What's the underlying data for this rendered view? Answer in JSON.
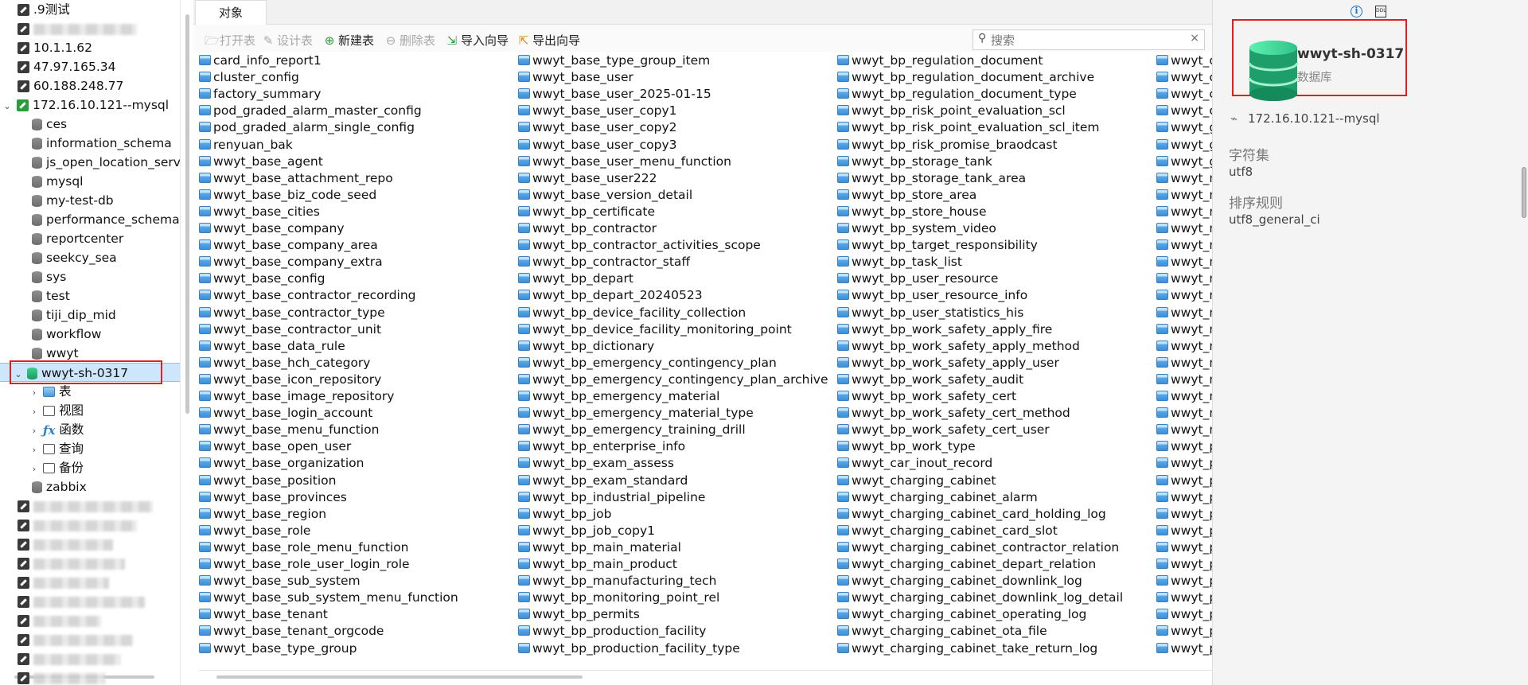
{
  "tree": {
    "connections_top": [
      {
        "label": ".9测试",
        "blurred": false
      },
      {
        "label": "",
        "blurred": true
      },
      {
        "label": "10.1.1.62",
        "blurred": false
      },
      {
        "label": "47.97.165.34",
        "blurred": false
      },
      {
        "label": "60.188.248.77",
        "blurred": false
      }
    ],
    "active_connection": "172.16.10.121--mysql",
    "databases": [
      "ces",
      "information_schema",
      "js_open_location_serve",
      "mysql",
      "my-test-db",
      "performance_schema",
      "reportcenter",
      "seekcy_sea",
      "sys",
      "test",
      "tiji_dip_mid",
      "workflow",
      "wwyt"
    ],
    "selected_database": "wwyt-sh-0317",
    "sub_nodes": [
      {
        "label": "表",
        "icon": "table-icon"
      },
      {
        "label": "视图",
        "icon": "view-icon"
      },
      {
        "label": "函数",
        "icon": "function-icon"
      },
      {
        "label": "查询",
        "icon": "query-icon"
      },
      {
        "label": "备份",
        "icon": "backup-icon"
      }
    ],
    "last_database": "zabbix"
  },
  "tabs": {
    "objects": "对象"
  },
  "toolbar": {
    "open_table": "打开表",
    "design_table": "设计表",
    "new_table": "新建表",
    "delete_table": "删除表",
    "import_wizard": "导入向导",
    "export_wizard": "导出向导"
  },
  "search": {
    "placeholder": "搜索",
    "value": ""
  },
  "tables": {
    "col1": [
      "card_info_report1",
      "cluster_config",
      "factory_summary",
      "pod_graded_alarm_master_config",
      "pod_graded_alarm_single_config",
      "renyuan_bak",
      "wwyt_base_agent",
      "wwyt_base_attachment_repo",
      "wwyt_base_biz_code_seed",
      "wwyt_base_cities",
      "wwyt_base_company",
      "wwyt_base_company_area",
      "wwyt_base_company_extra",
      "wwyt_base_config",
      "wwyt_base_contractor_recording",
      "wwyt_base_contractor_type",
      "wwyt_base_contractor_unit",
      "wwyt_base_data_rule",
      "wwyt_base_hch_category",
      "wwyt_base_icon_repository",
      "wwyt_base_image_repository",
      "wwyt_base_login_account",
      "wwyt_base_menu_function",
      "wwyt_base_open_user",
      "wwyt_base_organization",
      "wwyt_base_position",
      "wwyt_base_provinces",
      "wwyt_base_region",
      "wwyt_base_role",
      "wwyt_base_role_menu_function",
      "wwyt_base_role_user_login_role",
      "wwyt_base_sub_system",
      "wwyt_base_sub_system_menu_function",
      "wwyt_base_tenant",
      "wwyt_base_tenant_orgcode",
      "wwyt_base_type_group"
    ],
    "col2": [
      "wwyt_base_type_group_item",
      "wwyt_base_user",
      "wwyt_base_user_2025-01-15",
      "wwyt_base_user_copy1",
      "wwyt_base_user_copy2",
      "wwyt_base_user_copy3",
      "wwyt_base_user_menu_function",
      "wwyt_base_user222",
      "wwyt_base_version_detail",
      "wwyt_bp_certificate",
      "wwyt_bp_contractor",
      "wwyt_bp_contractor_activities_scope",
      "wwyt_bp_contractor_staff",
      "wwyt_bp_depart",
      "wwyt_bp_depart_20240523",
      "wwyt_bp_device_facility_collection",
      "wwyt_bp_device_facility_monitoring_point",
      "wwyt_bp_dictionary",
      "wwyt_bp_emergency_contingency_plan",
      "wwyt_bp_emergency_contingency_plan_archive",
      "wwyt_bp_emergency_material",
      "wwyt_bp_emergency_material_type",
      "wwyt_bp_emergency_training_drill",
      "wwyt_bp_enterprise_info",
      "wwyt_bp_exam_assess",
      "wwyt_bp_exam_standard",
      "wwyt_bp_industrial_pipeline",
      "wwyt_bp_job",
      "wwyt_bp_job_copy1",
      "wwyt_bp_main_material",
      "wwyt_bp_main_product",
      "wwyt_bp_manufacturing_tech",
      "wwyt_bp_monitoring_point_rel",
      "wwyt_bp_permits",
      "wwyt_bp_production_facility",
      "wwyt_bp_production_facility_type"
    ],
    "col3": [
      "wwyt_bp_regulation_document",
      "wwyt_bp_regulation_document_archive",
      "wwyt_bp_regulation_document_type",
      "wwyt_bp_risk_point_evaluation_scl",
      "wwyt_bp_risk_point_evaluation_scl_item",
      "wwyt_bp_risk_promise_braodcast",
      "wwyt_bp_storage_tank",
      "wwyt_bp_storage_tank_area",
      "wwyt_bp_store_area",
      "wwyt_bp_store_house",
      "wwyt_bp_system_video",
      "wwyt_bp_target_responsibility",
      "wwyt_bp_task_list",
      "wwyt_bp_user_resource",
      "wwyt_bp_user_resource_info",
      "wwyt_bp_user_statistics_his",
      "wwyt_bp_work_safety_apply_fire",
      "wwyt_bp_work_safety_apply_method",
      "wwyt_bp_work_safety_apply_user",
      "wwyt_bp_work_safety_audit",
      "wwyt_bp_work_safety_cert",
      "wwyt_bp_work_safety_cert_method",
      "wwyt_bp_work_safety_cert_user",
      "wwyt_bp_work_type",
      "wwyt_car_inout_record",
      "wwyt_charging_cabinet",
      "wwyt_charging_cabinet_alarm",
      "wwyt_charging_cabinet_card_holding_log",
      "wwyt_charging_cabinet_card_slot",
      "wwyt_charging_cabinet_contractor_relation",
      "wwyt_charging_cabinet_depart_relation",
      "wwyt_charging_cabinet_downlink_log",
      "wwyt_charging_cabinet_downlink_log_detail",
      "wwyt_charging_cabinet_operating_log",
      "wwyt_charging_cabinet_ota_file",
      "wwyt_charging_cabinet_take_return_log"
    ],
    "col4": [
      "wwyt_c",
      "wwyt_c",
      "wwyt_c",
      "wwyt_c",
      "wwyt_g",
      "wwyt_g",
      "wwyt_g",
      "wwyt_n",
      "wwyt_n",
      "wwyt_n",
      "wwyt_n",
      "wwyt_n",
      "wwyt_n",
      "wwyt_n",
      "wwyt_n",
      "wwyt_n",
      "wwyt_n",
      "wwyt_n",
      "wwyt_n",
      "wwyt_n",
      "wwyt_n",
      "wwyt_n",
      "wwyt_n",
      "wwyt_p",
      "wwyt_p",
      "wwyt_p",
      "wwyt_p",
      "wwyt_p",
      "wwyt_p",
      "wwyt_p",
      "wwyt_p",
      "wwyt_p",
      "wwyt_p",
      "wwyt_p",
      "wwyt_p",
      "wwyt_p"
    ]
  },
  "info_panel": {
    "db_name": "wwyt-sh-0317",
    "db_type": "数据库",
    "connection": "172.16.10.121--mysql",
    "charset_label": "字符集",
    "charset_value": "utf8",
    "collation_label": "排序规则",
    "collation_value": "utf8_general_ci",
    "ddl_icon_text": "DDL"
  },
  "colors": {
    "accent": "#2a9d3a",
    "highlight_border": "#e02020",
    "selection": "#cde6fb"
  }
}
